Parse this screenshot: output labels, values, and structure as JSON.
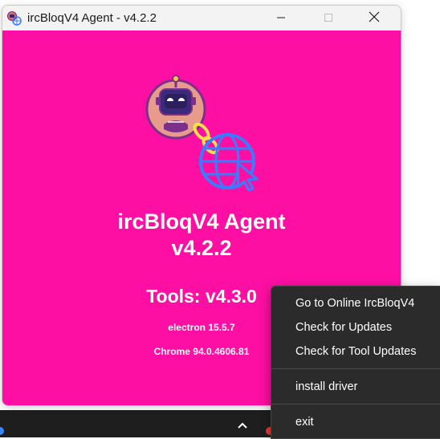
{
  "window": {
    "title": "ircBloqV4 Agent - v4.2.2",
    "icons": {
      "app": "app-logo-icon",
      "minimize": "minimize-icon",
      "maximize": "maximize-icon",
      "close": "close-icon"
    }
  },
  "content": {
    "background_color": "#fc0fa2",
    "logo_icon": "robot-globe-logo-icon",
    "agent_name": "ircBloqV4 Agent",
    "agent_version": "v4.2.2",
    "tools_label": "Tools: v4.3.0",
    "electron_label": "electron 15.5.7",
    "chrome_label": "Chrome 94.0.4606.81"
  },
  "context_menu": {
    "items": [
      "Go to Online IrcBloqV4",
      "Check for Updates",
      "Check for Tool Updates",
      "install driver",
      "exit"
    ]
  },
  "taskbar": {
    "chevron_icon": "chevron-up-icon"
  }
}
